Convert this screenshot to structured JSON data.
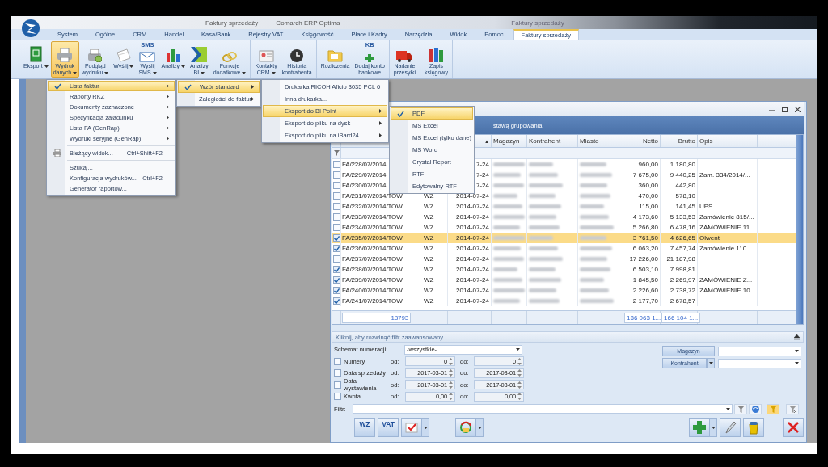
{
  "window": {
    "title": "Faktury sprzedaży",
    "app_name": "Comarch ERP Optima",
    "context_title": "Faktury sprzedaży"
  },
  "ribbon_tabs": [
    {
      "label": "System",
      "selected": false
    },
    {
      "label": "Ogólne",
      "selected": false
    },
    {
      "label": "CRM",
      "selected": false
    },
    {
      "label": "Handel",
      "selected": false
    },
    {
      "label": "Kasa/Bank",
      "selected": false
    },
    {
      "label": "Rejestry VAT",
      "selected": false
    },
    {
      "label": "Księgowość",
      "selected": false
    },
    {
      "label": "Płace i Kadry",
      "selected": false
    },
    {
      "label": "Narzędzia",
      "selected": false
    },
    {
      "label": "Widok",
      "selected": false
    },
    {
      "label": "Pomoc",
      "selected": false
    },
    {
      "label": "Faktury sprzedaży",
      "selected": true
    }
  ],
  "ribbon_groups": [
    {
      "buttons": [
        {
          "label": [
            "Eksport"
          ],
          "has_menu": true,
          "pressed": false
        },
        {
          "label": [
            "Wydruk",
            "danych"
          ],
          "has_menu": true,
          "pressed": true
        },
        {
          "label": [
            "Podgląd",
            "wydruku"
          ],
          "has_menu": true,
          "pressed": false
        },
        {
          "label": [
            "Wyślij"
          ],
          "has_menu": true,
          "pressed": false
        },
        {
          "label": [
            "Wyślij",
            "SMS"
          ],
          "has_menu": true,
          "pressed": false,
          "icon_text": "SMS"
        },
        {
          "label": [
            "Analizy"
          ],
          "has_menu": true,
          "pressed": false
        },
        {
          "label": [
            "Analizy",
            "BI"
          ],
          "has_menu": true,
          "pressed": false
        },
        {
          "label": [
            "Funkcje",
            "dodatkowe"
          ],
          "has_menu": true,
          "pressed": false
        }
      ]
    },
    {
      "buttons": [
        {
          "label": [
            "Kontakty",
            "CRM"
          ],
          "has_menu": true,
          "pressed": false
        },
        {
          "label": [
            "Historia",
            "kontrahenta"
          ],
          "has_menu": false,
          "pressed": false
        }
      ]
    },
    {
      "buttons": [
        {
          "label": [
            "Rozliczenia"
          ],
          "has_menu": false,
          "pressed": false
        },
        {
          "label": [
            "Dodaj konto",
            "bankowe"
          ],
          "has_menu": false,
          "pressed": false,
          "icon_text": "KB"
        }
      ]
    },
    {
      "buttons": [
        {
          "label": [
            "Nadanie",
            "przesyłki"
          ],
          "has_menu": false,
          "pressed": false
        }
      ]
    },
    {
      "buttons": [
        {
          "label": [
            "Zapis",
            "księgowy"
          ],
          "has_menu": false,
          "pressed": false
        }
      ]
    }
  ],
  "menus": [
    {
      "items": [
        {
          "kind": "item",
          "label": "Lista faktur",
          "checked": true,
          "selected": true,
          "submenu": true
        },
        {
          "kind": "item",
          "label": "Raporty RKZ",
          "checked": false,
          "selected": false,
          "submenu": true
        },
        {
          "kind": "item",
          "label": "Dokumenty zaznaczone",
          "checked": false,
          "selected": false,
          "submenu": true
        },
        {
          "kind": "item",
          "label": "Specyfikacja załadunku",
          "checked": false,
          "selected": false,
          "submenu": true
        },
        {
          "kind": "item",
          "label": "Lista FA (GenRap)",
          "checked": false,
          "selected": false,
          "submenu": true
        },
        {
          "kind": "item",
          "label": "Wydruki seryjne (GenRap)",
          "checked": false,
          "selected": false,
          "submenu": true
        },
        {
          "kind": "separator"
        },
        {
          "kind": "item",
          "label": "Bieżący widok...",
          "shortcut": "Ctrl+Shift+F2",
          "icon": true,
          "checked": false,
          "selected": false,
          "submenu": false
        },
        {
          "kind": "separator"
        },
        {
          "kind": "item",
          "label": "Szukaj...",
          "checked": false,
          "selected": false,
          "submenu": false
        },
        {
          "kind": "item",
          "label": "Konfiguracja wydruków...",
          "shortcut": "Ctrl+F2",
          "checked": false,
          "selected": false,
          "submenu": false
        },
        {
          "kind": "item",
          "label": "Generator raportów...",
          "checked": false,
          "selected": false,
          "submenu": false
        }
      ]
    },
    {
      "items": [
        {
          "kind": "item",
          "label": "Wzór standard",
          "checked": true,
          "selected": true,
          "submenu": true
        },
        {
          "kind": "item",
          "label": "Zaległości do faktur",
          "checked": false,
          "selected": false,
          "submenu": true
        }
      ]
    },
    {
      "items": [
        {
          "kind": "item",
          "label": "Drukarka RICOH Aficio 3035 PCL 6",
          "checked": false,
          "selected": false,
          "submenu": false
        },
        {
          "kind": "item",
          "label": "Inna drukarka...",
          "checked": false,
          "selected": false,
          "submenu": false
        },
        {
          "kind": "item",
          "label": "Eksport do BI Point",
          "checked": false,
          "selected": true,
          "submenu": true
        },
        {
          "kind": "item",
          "label": "Eksport do pliku na dysk",
          "checked": false,
          "selected": false,
          "submenu": true
        },
        {
          "kind": "item",
          "label": "Eksport do pliku na iBard24",
          "checked": false,
          "selected": false,
          "submenu": true
        }
      ]
    },
    {
      "items": [
        {
          "kind": "item",
          "label": "PDF",
          "checked": true,
          "selected": true,
          "submenu": false
        },
        {
          "kind": "item",
          "label": "MS Excel",
          "checked": false,
          "selected": false,
          "submenu": false
        },
        {
          "kind": "item",
          "label": "MS Excel (tylko dane)",
          "checked": false,
          "selected": false,
          "submenu": false
        },
        {
          "kind": "item",
          "label": "MS Word",
          "checked": false,
          "selected": false,
          "submenu": false
        },
        {
          "kind": "item",
          "label": "Crystal Report",
          "checked": false,
          "selected": false,
          "submenu": false
        },
        {
          "kind": "item",
          "label": "RTF",
          "checked": false,
          "selected": false,
          "submenu": false
        },
        {
          "kind": "item",
          "label": "Edytowalny RTF",
          "checked": false,
          "selected": false,
          "submenu": false
        }
      ]
    }
  ],
  "invoice_list": {
    "group_panel_text": "stawą grupowania",
    "sort_indicator": "▲",
    "columns": [
      {
        "label": "Magazyn"
      },
      {
        "label": "Kontrahent"
      },
      {
        "label": "Miasto"
      },
      {
        "label": "Netto"
      },
      {
        "label": "Brutto"
      },
      {
        "label": "Opis"
      }
    ],
    "rows": [
      {
        "number": "FA/228/07/2014",
        "date": "7-24",
        "netto": "960,00",
        "brutto": "1 180,80",
        "checked": false,
        "selected": false
      },
      {
        "number": "FA/229/07/2014",
        "date": "7-24",
        "netto": "7 675,00",
        "brutto": "9 440,25",
        "opis": "Zam. 334/2014/...",
        "checked": false,
        "selected": false
      },
      {
        "number": "FA/230/07/2014",
        "date": "7-24",
        "netto": "360,00",
        "brutto": "442,80",
        "checked": false,
        "selected": false
      },
      {
        "number": "FA/231/07/2014/TOW",
        "type": "WZ",
        "date": "2014-07-24",
        "netto": "470,00",
        "brutto": "578,10",
        "checked": false,
        "selected": false
      },
      {
        "number": "FA/232/07/2014/TOW",
        "type": "WZ",
        "date": "2014-07-24",
        "netto": "115,00",
        "brutto": "141,45",
        "opis": "UPS",
        "checked": false,
        "selected": false
      },
      {
        "number": "FA/233/07/2014/TOW",
        "type": "WZ",
        "date": "2014-07-24",
        "netto": "4 173,60",
        "brutto": "5 133,53",
        "opis": "Zamówienie 815/...",
        "checked": false,
        "selected": false
      },
      {
        "number": "FA/234/07/2014/TOW",
        "type": "WZ",
        "date": "2014-07-24",
        "netto": "5 266,80",
        "brutto": "6 478,16",
        "opis": "ZAMÓWIENIE 11...",
        "checked": false,
        "selected": false
      },
      {
        "number": "FA/235/07/2014/TOW",
        "type": "WZ",
        "date": "2014-07-24",
        "netto": "3 761,50",
        "brutto": "4 626,65",
        "opis": "Olwent",
        "checked": true,
        "selected": true
      },
      {
        "number": "FA/236/07/2014/TOW",
        "type": "WZ",
        "date": "2014-07-24",
        "netto": "6 063,20",
        "brutto": "7 457,74",
        "opis": "Zamówienie 110...",
        "checked": true,
        "selected": false
      },
      {
        "number": "FA/237/07/2014/TOW",
        "type": "WZ",
        "date": "2014-07-24",
        "netto": "17 226,00",
        "brutto": "21 187,98",
        "checked": false,
        "selected": false
      },
      {
        "number": "FA/238/07/2014/TOW",
        "type": "WZ",
        "date": "2014-07-24",
        "netto": "6 503,10",
        "brutto": "7 998,81",
        "checked": true,
        "selected": false
      },
      {
        "number": "FA/239/07/2014/TOW",
        "type": "WZ",
        "date": "2014-07-24",
        "netto": "1 845,50",
        "brutto": "2 269,97",
        "opis": "ZAMÓWIENIE Z...",
        "checked": true,
        "selected": false
      },
      {
        "number": "FA/240/07/2014/TOW",
        "type": "WZ",
        "date": "2014-07-24",
        "netto": "2 226,60",
        "brutto": "2 738,72",
        "opis": "ZAMÓWIENIE 10...",
        "checked": true,
        "selected": false
      },
      {
        "number": "FA/241/07/2014/TOW",
        "type": "WZ",
        "date": "2014-07-24",
        "netto": "2 177,70",
        "brutto": "2 678,57",
        "checked": true,
        "selected": false
      }
    ],
    "totals": {
      "count": "18793",
      "netto": "136 063 1...",
      "brutto": "166 104 1..."
    }
  },
  "filter_panel": {
    "header": "Kliknij, aby rozwinąć filtr zaawansowany",
    "scheme_label": "Schemat numeracji:",
    "scheme_value": "-wszystkie-",
    "ranges": [
      {
        "label": "Numery",
        "checked": false,
        "from_label": "od:",
        "from": "0",
        "to_label": "do:",
        "to": "0"
      },
      {
        "label": "Data sprzedaży",
        "checked": false,
        "from_label": "od:",
        "from": "2017-03-01",
        "to_label": "do:",
        "to": "2017-03-01"
      },
      {
        "label": "Data wystawienia",
        "checked": false,
        "from_label": "od:",
        "from": "2017-03-01",
        "to_label": "do:",
        "to": "2017-03-01"
      },
      {
        "label": "Kwota",
        "checked": false,
        "from_label": "od:",
        "from": "0,00",
        "to_label": "do:",
        "to": "0,00"
      }
    ],
    "side_buttons": [
      {
        "label": "Magazyn",
        "has_menu": false
      },
      {
        "label": "Kontrahent",
        "has_menu": true
      }
    ],
    "filter_label": "Filtr:"
  },
  "bottom_toolbar": {
    "left": [
      {
        "kind": "text",
        "text": "WZ",
        "has_menu": false
      },
      {
        "kind": "text",
        "text": "VAT",
        "has_menu": false
      },
      {
        "kind": "check",
        "has_menu": true
      },
      {
        "kind": "cycle",
        "has_menu": true
      }
    ],
    "right": [
      {
        "kind": "add",
        "has_menu": true
      },
      {
        "kind": "edit",
        "has_menu": false
      },
      {
        "kind": "delete",
        "has_menu": false
      },
      {
        "kind": "close",
        "has_menu": false
      }
    ]
  }
}
